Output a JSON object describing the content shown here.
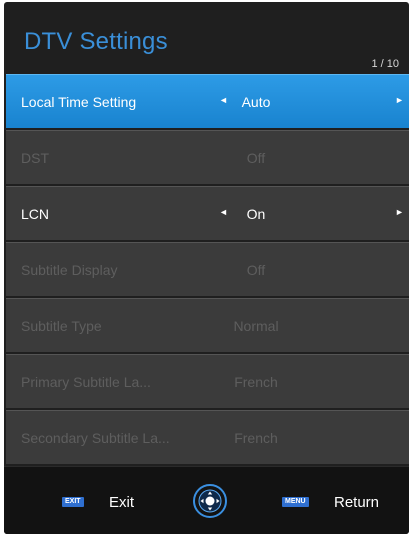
{
  "header": {
    "title": "DTV Settings",
    "page_indicator": "1 / 10"
  },
  "menu": {
    "items": [
      {
        "label": "Local Time Setting",
        "value": "Auto",
        "state": "selected"
      },
      {
        "label": "DST",
        "value": "Off",
        "state": "disabled"
      },
      {
        "label": "LCN",
        "value": "On",
        "state": "enabled"
      },
      {
        "label": "Subtitle Display",
        "value": "Off",
        "state": "disabled"
      },
      {
        "label": "Subtitle Type",
        "value": "Normal",
        "state": "disabled"
      },
      {
        "label": "Primary Subtitle La...",
        "value": "French",
        "state": "disabled"
      },
      {
        "label": "Secondary Subtitle La...",
        "value": "French",
        "state": "disabled"
      }
    ],
    "arrow_left": "◄",
    "arrow_right": "►"
  },
  "footer": {
    "exit_key": "EXIT",
    "exit_label": "Exit",
    "menu_key": "MENU",
    "return_label": "Return",
    "nav_icon": "remote-navigation-icon"
  },
  "colors": {
    "accent": "#2190dc",
    "title": "#3a8fd8",
    "panel": "#1f1f1f",
    "row": "#3b3b3b",
    "disabled_text": "#5e5e5e"
  }
}
